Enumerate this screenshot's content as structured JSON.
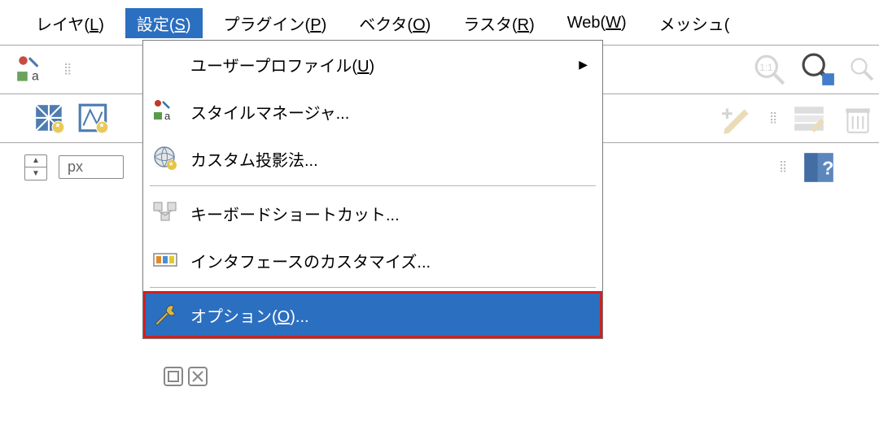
{
  "menubar": {
    "items": [
      {
        "label": "レイヤ(L)",
        "mnemonic": "L"
      },
      {
        "label": "設定(S)",
        "mnemonic": "S",
        "active": true
      },
      {
        "label": "プラグイン(P)",
        "mnemonic": "P"
      },
      {
        "label": "ベクタ(O)",
        "mnemonic": "O"
      },
      {
        "label": "ラスタ(R)",
        "mnemonic": "R"
      },
      {
        "label": "Web(W)",
        "mnemonic": "W"
      },
      {
        "label": "メッシュ(",
        "mnemonic": ""
      }
    ]
  },
  "settings_menu": {
    "items": [
      {
        "icon": "blank",
        "label": "ユーザープロファイル(U)",
        "submenu": true
      },
      {
        "icon": "style-manager",
        "label": "スタイルマネージャ..."
      },
      {
        "icon": "globe-gear",
        "label": "カスタム投影法..."
      },
      {
        "icon": "shortcut",
        "label": "キーボードショートカット..."
      },
      {
        "icon": "customize",
        "label": "インタフェースのカスタマイズ..."
      },
      {
        "icon": "wrench",
        "label": "オプション(O)...",
        "highlight": true
      }
    ]
  },
  "row3": {
    "unit": "px"
  }
}
